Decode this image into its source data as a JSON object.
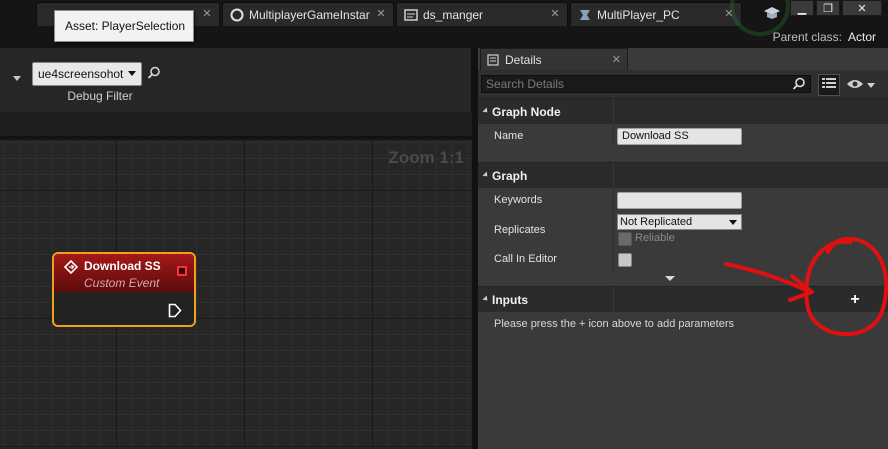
{
  "tabs": [
    {
      "label": "",
      "icon": "blueprint-icon"
    },
    {
      "label": "MultiplayerGameInstar",
      "icon": "game-instance-icon"
    },
    {
      "label": "ds_manger",
      "icon": "widget-icon"
    },
    {
      "label": "MultiPlayer_PC",
      "icon": "player-controller-icon"
    }
  ],
  "tooltip": "Asset: PlayerSelection",
  "window_controls": {
    "minimize": "▁",
    "restore": "❐",
    "close": "✕"
  },
  "parent_class": {
    "label": "Parent class:",
    "value": "Actor"
  },
  "graph": {
    "debug_filter_value": "ue4screensohot",
    "debug_filter_label": "Debug Filter",
    "zoom": "Zoom 1:1",
    "node": {
      "title": "Download SS",
      "subtitle": "Custom Event"
    }
  },
  "details": {
    "tab_label": "Details",
    "search_placeholder": "Search Details",
    "graph_node_section": "Graph Node",
    "name_label": "Name",
    "name_value": "Download SS",
    "graph_section": "Graph",
    "keywords_label": "Keywords",
    "keywords_value": "",
    "replicates_label": "Replicates",
    "replicates_value": "Not Replicated",
    "reliable_label": "Reliable",
    "call_in_editor_label": "Call In Editor",
    "inputs_section": "Inputs",
    "add_param_symbol": "+",
    "inputs_hint": "Please press the + icon above to add parameters"
  },
  "colors": {
    "node_border": "#f0a020",
    "node_header": "#a61818",
    "annotation": "#e01010"
  }
}
